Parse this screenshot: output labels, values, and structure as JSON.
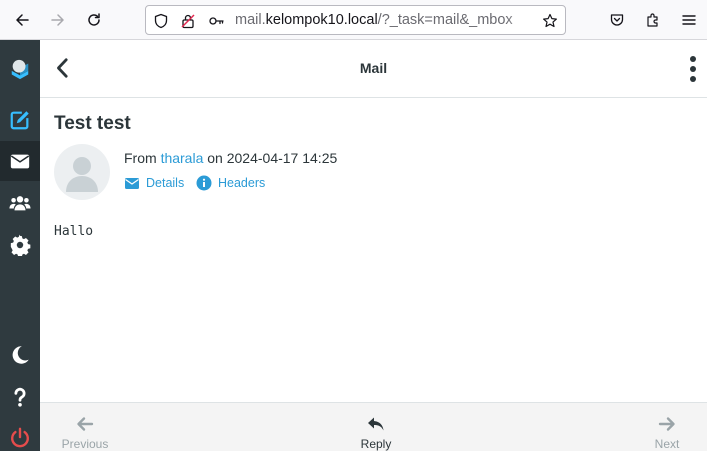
{
  "browser": {
    "url_prefix": "mail.",
    "url_host": "kelompok10.local",
    "url_rest": "/?_task=mail&_mbox"
  },
  "header": {
    "title": "Mail"
  },
  "message": {
    "subject": "Test test",
    "from_label": "From",
    "sender": "tharala",
    "on_label": "on",
    "date": "2024-04-17 14:25",
    "details_link": "Details",
    "headers_link": "Headers",
    "body": "Hallo"
  },
  "footer": {
    "previous": "Previous",
    "reply": "Reply",
    "next": "Next"
  },
  "colors": {
    "nav_bg": "#2f3a3f",
    "accent": "#37beff",
    "logout": "#e54c4c"
  }
}
